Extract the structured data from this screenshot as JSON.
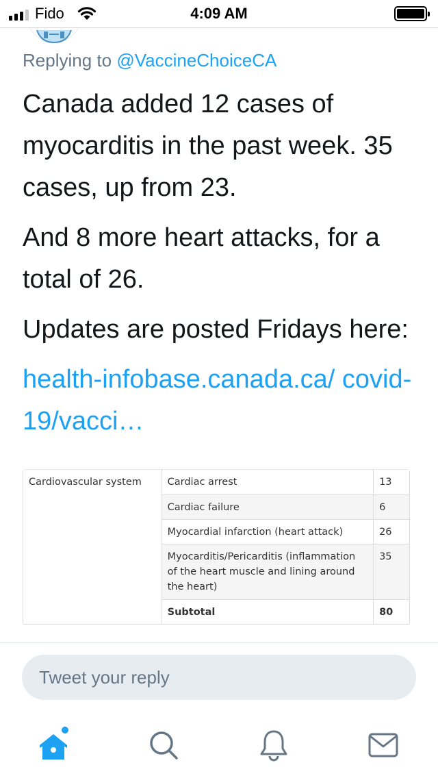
{
  "status_bar": {
    "carrier": "Fido",
    "time": "4:09 AM",
    "signal_bars_filled": 3,
    "signal_bars_total": 4,
    "battery_level": 1.0
  },
  "tweet": {
    "replying_prefix": "Replying to",
    "replying_handle": "@VaccineChoiceCA",
    "paragraphs": {
      "p1": "Canada added 12 cases of myocarditis in the past week. 35 cases, up from 23.",
      "p2": "And 8 more heart attacks, for a total of 26.",
      "p3": "Updates are posted Fridays here:",
      "link": "health-infobase.canada.ca/ covid-19/vacci…"
    }
  },
  "media_table": {
    "system": "Cardiovascular system",
    "rows": [
      {
        "reaction": "Cardiac arrest",
        "count": "13"
      },
      {
        "reaction": "Cardiac failure",
        "count": "6"
      },
      {
        "reaction": "Myocardial infarction (heart attack)",
        "count": "26"
      },
      {
        "reaction": "Myocarditis/Pericarditis (inflammation of the heart muscle and lining around the heart)",
        "count": "35"
      },
      {
        "reaction": "Subtotal",
        "count": "80"
      }
    ]
  },
  "reply": {
    "placeholder": "Tweet your reply"
  },
  "tab_bar": {
    "tabs": [
      {
        "icon": "home-icon",
        "active": true,
        "has_badge": true
      },
      {
        "icon": "search-icon",
        "active": false
      },
      {
        "icon": "bell-icon",
        "active": false
      },
      {
        "icon": "mail-icon",
        "active": false
      }
    ]
  },
  "colors": {
    "accent": "#1da1f2",
    "text": "#14171a",
    "muted": "#657786",
    "reply_bg": "#e6ecf0",
    "icon_gray": "#657786"
  }
}
